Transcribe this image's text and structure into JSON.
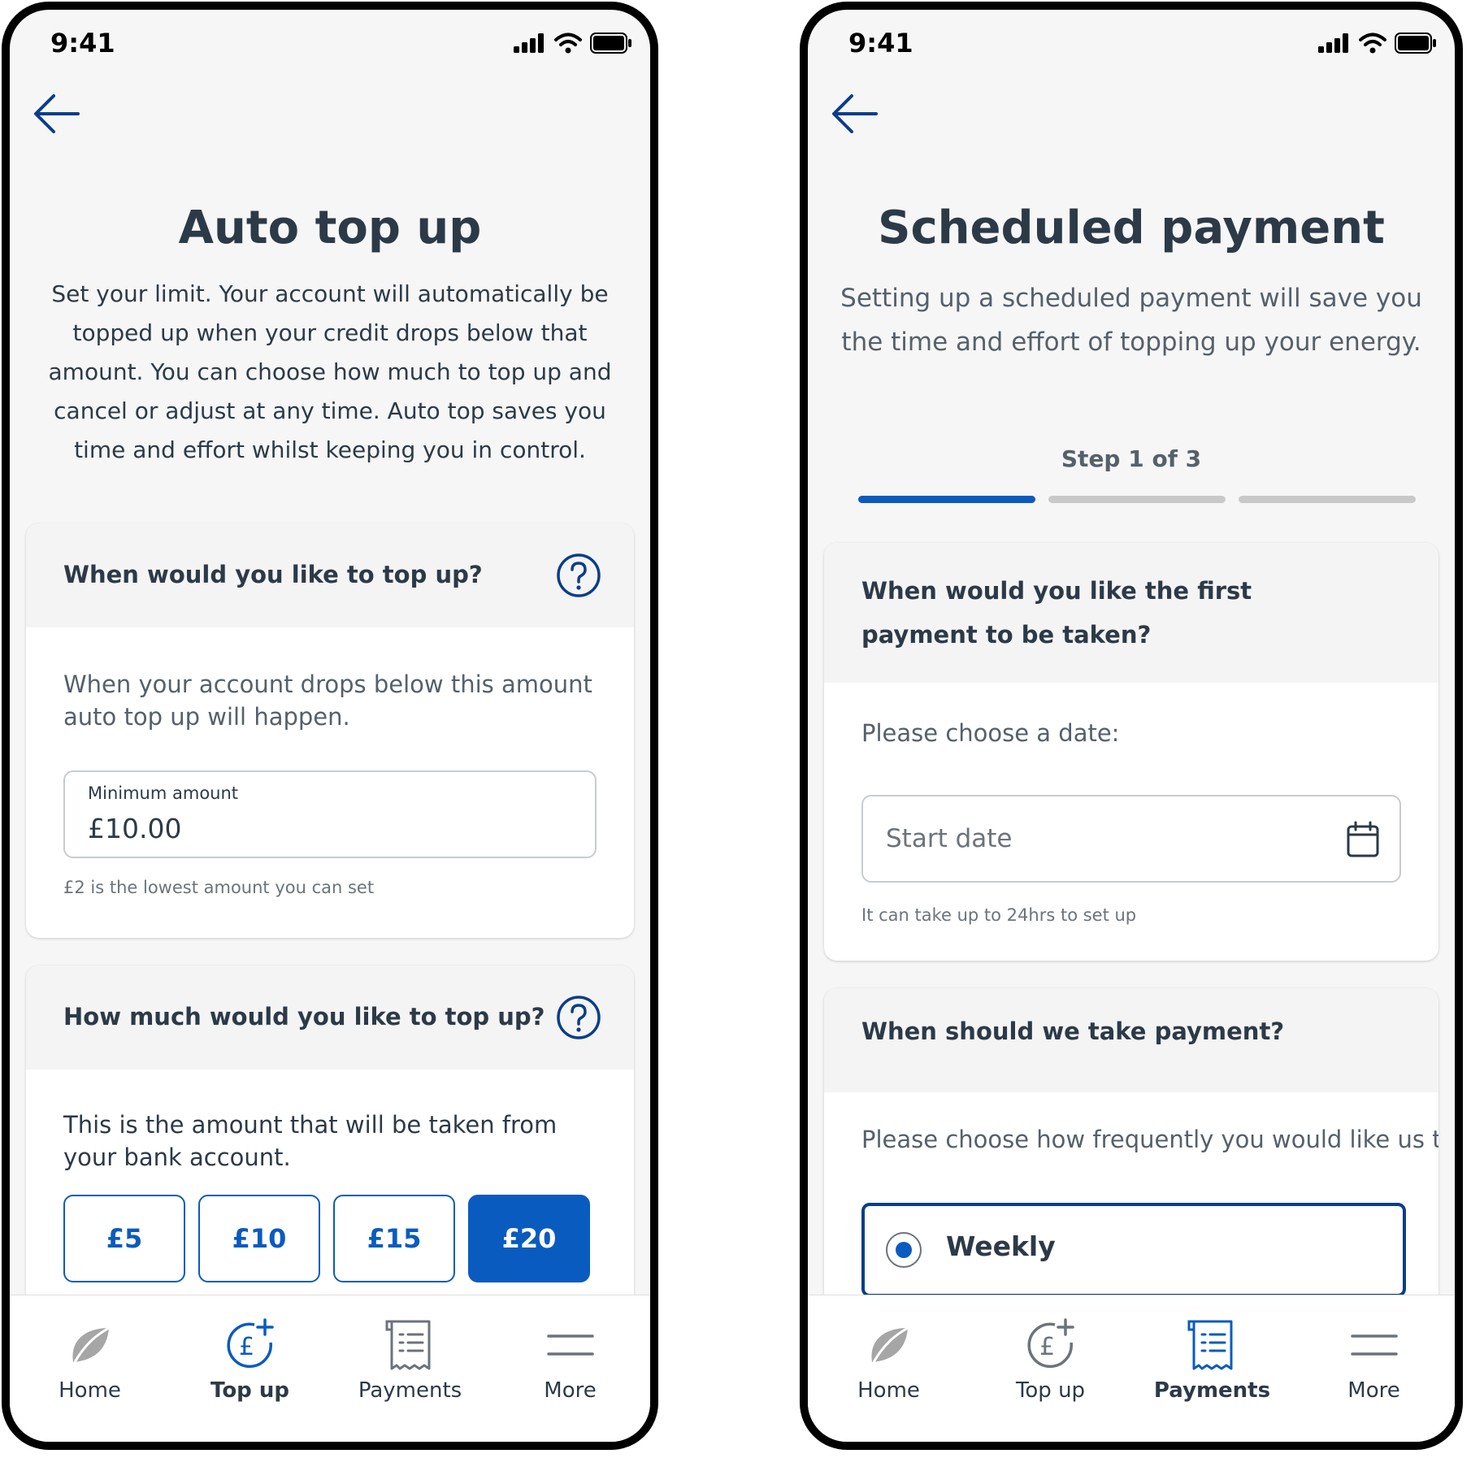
{
  "status_bar": {
    "time": "9:41"
  },
  "left_screen": {
    "title": "Auto top up",
    "intro": "Set your limit. Your account will automatically be topped up when your credit drops below that amount. You can choose how much to top up and cancel or adjust at any time. Auto top saves you time and effort whilst keeping you in control.",
    "card1": {
      "heading": "When would you like to top up?",
      "body": "When your account drops below this amount auto top up will happen.",
      "input_label": "Minimum amount",
      "input_value": "£10.00",
      "hint": "£2 is the lowest amount you can set"
    },
    "card2": {
      "heading": "How much would you like to top up?",
      "body": "This is the amount that will be taken from your bank account.",
      "amounts": [
        "£5",
        "£10",
        "£15",
        "£20"
      ],
      "selected_amount": "£20"
    },
    "active_tab": "Top up"
  },
  "right_screen": {
    "title": "Scheduled payment",
    "intro": "Setting up a scheduled payment will save you the time and effort of topping up your energy.",
    "step_label": "Step 1 of 3",
    "progress": {
      "current": 1,
      "total": 3
    },
    "card1": {
      "heading": "When would you like the first payment to be taken?",
      "body": "Please choose a date:",
      "input_placeholder": "Start date",
      "hint": "It can take up to 24hrs to set up"
    },
    "card2": {
      "heading": "When should we take payment?",
      "body": "Please choose how frequently you would like us t",
      "option": "Weekly"
    },
    "active_tab": "Payments"
  },
  "tabs": {
    "home": "Home",
    "topup": "Top up",
    "payments": "Payments",
    "more": "More"
  },
  "colors": {
    "accent": "#0a5bbf",
    "navy": "#0a3d8a",
    "text": "#2c3a48"
  }
}
